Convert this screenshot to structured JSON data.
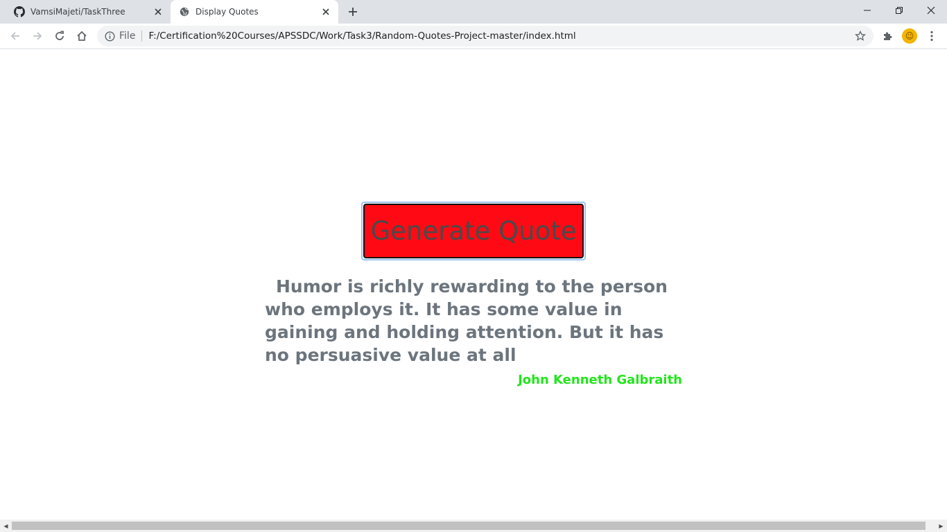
{
  "browser": {
    "tabs": [
      {
        "title": "VamsiMajeti/TaskThree",
        "icon": "github-icon",
        "active": false
      },
      {
        "title": "Display Quotes",
        "icon": "globe-icon",
        "active": true
      }
    ],
    "omnibox": {
      "scheme_label": "File",
      "url": "F:/Certification%20Courses/APSSDC/Work/Task3/Random-Quotes-Project-master/index.html"
    }
  },
  "page": {
    "button_label": "Generate Quote",
    "quote_text": "Humor is richly rewarding to the person who employs it. It has some value in gaining and holding attention. But it has no persuasive value at all",
    "author": "John Kenneth Galbraith",
    "colors": {
      "button_bg": "#ff0a14",
      "quote_text": "#6c757d",
      "author_text": "#22e51b"
    }
  }
}
